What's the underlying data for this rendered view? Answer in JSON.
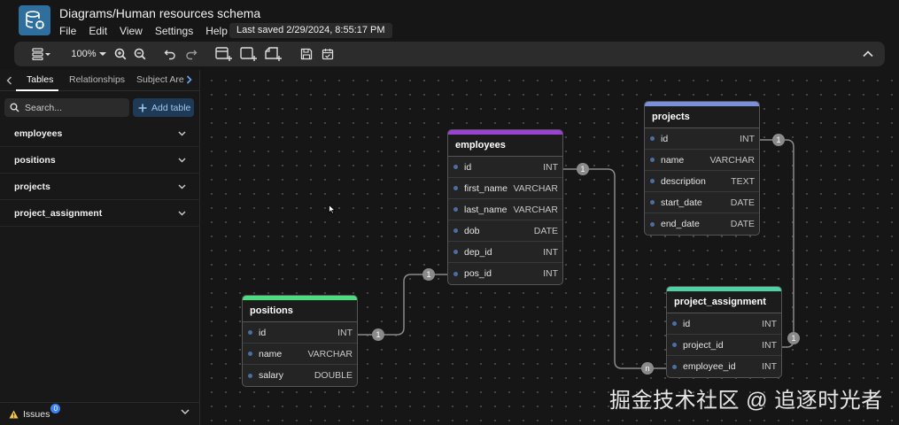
{
  "header": {
    "title": "Diagrams/Human resources schema",
    "menu": [
      "File",
      "Edit",
      "View",
      "Settings",
      "Help"
    ],
    "last_saved": "Last saved 2/29/2024, 8:55:17 PM"
  },
  "toolbar": {
    "zoom": "100%"
  },
  "sidebar": {
    "tabs": [
      "Tables",
      "Relationships",
      "Subject Are"
    ],
    "active_tab": "Tables",
    "search_placeholder": "Search...",
    "add_table_label": "Add table",
    "tables": [
      "employees",
      "positions",
      "projects",
      "project_assignment"
    ],
    "issues_label": "Issues",
    "issues_count": "0"
  },
  "canvas": {
    "tables": [
      {
        "name": "employees",
        "color": "#9b42d4",
        "fields": [
          {
            "name": "id",
            "type": "INT"
          },
          {
            "name": "first_name",
            "type": "VARCHAR"
          },
          {
            "name": "last_name",
            "type": "VARCHAR"
          },
          {
            "name": "dob",
            "type": "DATE"
          },
          {
            "name": "dep_id",
            "type": "INT"
          },
          {
            "name": "pos_id",
            "type": "INT"
          }
        ]
      },
      {
        "name": "projects",
        "color": "#7c8fdc",
        "fields": [
          {
            "name": "id",
            "type": "INT"
          },
          {
            "name": "name",
            "type": "VARCHAR"
          },
          {
            "name": "description",
            "type": "TEXT"
          },
          {
            "name": "start_date",
            "type": "DATE"
          },
          {
            "name": "end_date",
            "type": "DATE"
          }
        ]
      },
      {
        "name": "positions",
        "color": "#4ade80",
        "fields": [
          {
            "name": "id",
            "type": "INT"
          },
          {
            "name": "name",
            "type": "VARCHAR"
          },
          {
            "name": "salary",
            "type": "DOUBLE"
          }
        ]
      },
      {
        "name": "project_assignment",
        "color": "#4fd1a5",
        "fields": [
          {
            "name": "id",
            "type": "INT"
          },
          {
            "name": "project_id",
            "type": "INT"
          },
          {
            "name": "employee_id",
            "type": "INT"
          }
        ]
      }
    ],
    "cardinalities": [
      "1",
      "1",
      "1",
      "1",
      "1",
      "n"
    ]
  },
  "watermark": "掘金技术社区 @ 追逐时光者",
  "colors": {
    "background": "#161616",
    "toolbar": "#2c2c2c",
    "add_button": "#1f3a57",
    "link_line": "#8a8a8a"
  }
}
